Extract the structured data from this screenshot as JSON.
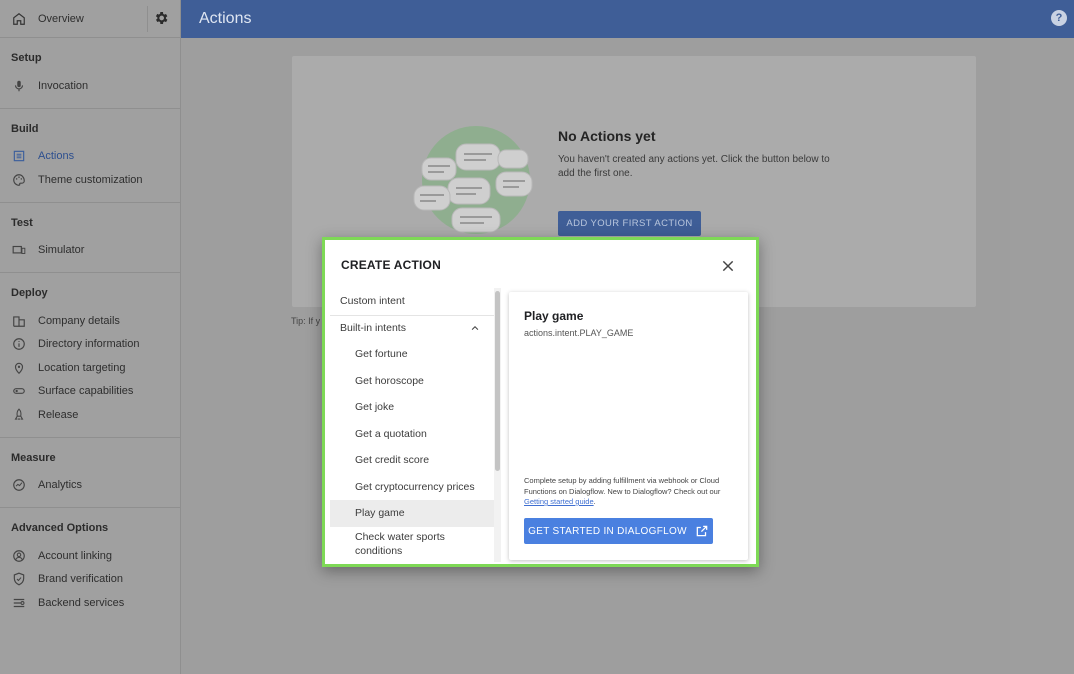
{
  "header": {
    "title": "Actions",
    "help_glyph": "?"
  },
  "sidebar": {
    "overview": "Overview",
    "sections": [
      {
        "title": "Setup",
        "items": [
          {
            "label": "Invocation",
            "icon": "mic-icon"
          }
        ]
      },
      {
        "title": "Build",
        "items": [
          {
            "label": "Actions",
            "icon": "list-icon",
            "active": true
          },
          {
            "label": "Theme customization",
            "icon": "palette-icon"
          }
        ]
      },
      {
        "title": "Test",
        "items": [
          {
            "label": "Simulator",
            "icon": "devices-icon"
          }
        ]
      },
      {
        "title": "Deploy",
        "items": [
          {
            "label": "Company details",
            "icon": "building-icon"
          },
          {
            "label": "Directory information",
            "icon": "info-icon"
          },
          {
            "label": "Location targeting",
            "icon": "location-pin-icon"
          },
          {
            "label": "Surface capabilities",
            "icon": "toggle-icon"
          },
          {
            "label": "Release",
            "icon": "rocket-icon"
          }
        ]
      },
      {
        "title": "Measure",
        "items": [
          {
            "label": "Analytics",
            "icon": "analytics-icon"
          }
        ]
      },
      {
        "title": "Advanced Options",
        "items": [
          {
            "label": "Account linking",
            "icon": "account-icon"
          },
          {
            "label": "Brand verification",
            "icon": "shield-check-icon"
          },
          {
            "label": "Backend services",
            "icon": "settings-list-icon"
          }
        ]
      }
    ]
  },
  "empty_state": {
    "title": "No Actions yet",
    "description": "You haven't created any actions yet. Click the button below to add the first one.",
    "button": "ADD YOUR FIRST ACTION",
    "tip": "Tip: If y"
  },
  "dialog": {
    "title": "CREATE ACTION",
    "custom_intent": "Custom intent",
    "builtin_group": "Built-in intents",
    "builtin_items": [
      "Get fortune",
      "Get horoscope",
      "Get joke",
      "Get a quotation",
      "Get credit score",
      "Get cryptocurrency prices",
      "Play game",
      "Check water sports conditions"
    ],
    "selected": "Play game",
    "detail": {
      "title": "Play game",
      "intent_id": "actions.intent.PLAY_GAME",
      "note": "Complete setup by adding fulfillment via webhook or Cloud Functions on Dialogflow. New to Dialogflow? Check out our",
      "note_link": "Getting started guide",
      "note_end": ".",
      "button": "GET STARTED IN DIALOGFLOW"
    }
  },
  "colors": {
    "header": "#3f5e97",
    "dialog_border": "#7ed956",
    "primary_button": "#4a80e0"
  }
}
